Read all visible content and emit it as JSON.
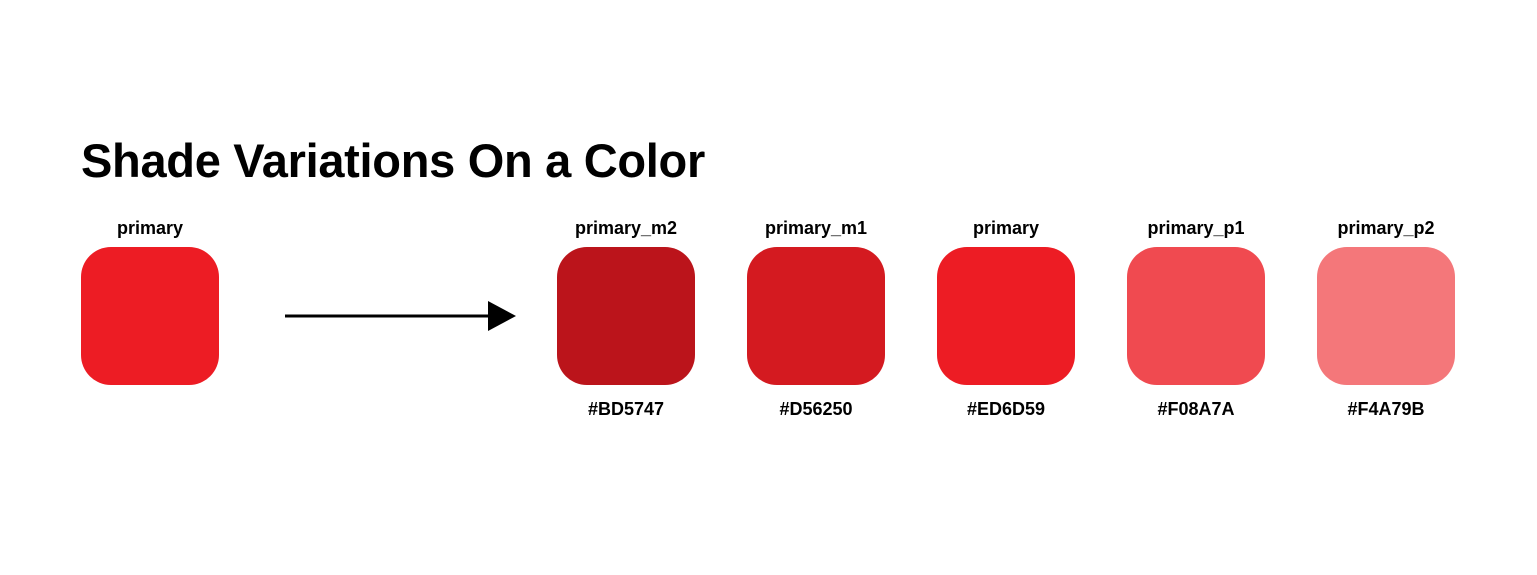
{
  "title": "Shade Variations On a Color",
  "source": {
    "label": "primary",
    "color": "#ED1C24"
  },
  "shades": [
    {
      "label": "primary_m2",
      "hex": "#BD5747",
      "color": "#BB141B"
    },
    {
      "label": "primary_m1",
      "hex": "#D56250",
      "color": "#D41A20"
    },
    {
      "label": "primary",
      "hex": "#ED6D59",
      "color": "#ED1C24"
    },
    {
      "label": "primary_p1",
      "hex": "#F08A7A",
      "color": "#F04A50"
    },
    {
      "label": "primary_p2",
      "hex": "#F4A79B",
      "color": "#F4777A"
    }
  ],
  "arrow_icon": "arrow-right-icon"
}
